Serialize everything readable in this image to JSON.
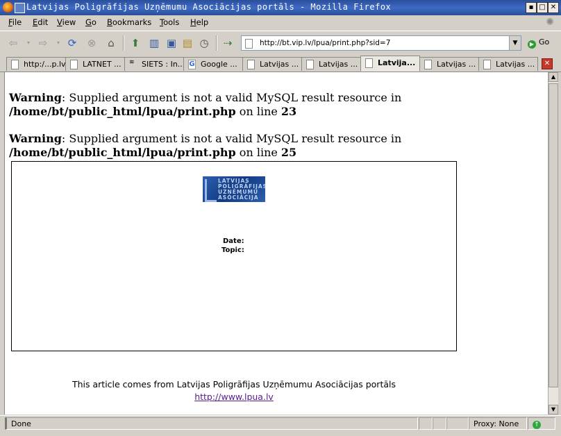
{
  "window": {
    "title": "Latvijas Poligrāfijas Uzņēmumu Asociācijas portāls - Mozilla Firefox"
  },
  "menu": [
    "File",
    "Edit",
    "View",
    "Go",
    "Bookmarks",
    "Tools",
    "Help"
  ],
  "toolbar": {
    "url": "http://bt.vip.lv/lpua/print.php?sid=7",
    "go_label": "Go",
    "icons": [
      "back-icon",
      "forward-icon",
      "reload-icon",
      "stop-icon",
      "home-icon",
      "bookmark-icon",
      "page-icon",
      "new-tab-icon",
      "bookmarks-icon",
      "history-icon",
      "send-icon"
    ]
  },
  "tabs": [
    {
      "label": "http:/...p.lv/"
    },
    {
      "label": "LATNET ..."
    },
    {
      "label": "SIETS : In..."
    },
    {
      "label": "Google ..."
    },
    {
      "label": "Latvijas ..."
    },
    {
      "label": "Latvijas ..."
    },
    {
      "label": "Latvija...",
      "active": true
    },
    {
      "label": "Latvijas ..."
    },
    {
      "label": "Latvijas ..."
    }
  ],
  "warnings": [
    {
      "label": "Warning",
      "message": ": Supplied argument is not a valid MySQL result resource in",
      "path": "/home/bt/public_html/lpua/print.php",
      "online": " on line ",
      "line": "23"
    },
    {
      "label": "Warning",
      "message": ": Supplied argument is not a valid MySQL result resource in",
      "path": "/home/bt/public_html/lpua/print.php",
      "online": " on line ",
      "line": "25"
    }
  ],
  "article": {
    "logo_text": [
      "LATVIJAS",
      "POLIGRĀFIJAS",
      "UZŅĒMUMU",
      "ASOCIĀCIJA"
    ],
    "date_label": "Date:",
    "topic_label": "Topic:"
  },
  "footer": {
    "text": "This article comes from Latvijas Poligrāfijas Uzņēmumu Asociācijas portāls",
    "link": "http://www.lpua.lv"
  },
  "status": {
    "text": "Done",
    "proxy": "Proxy: None"
  }
}
